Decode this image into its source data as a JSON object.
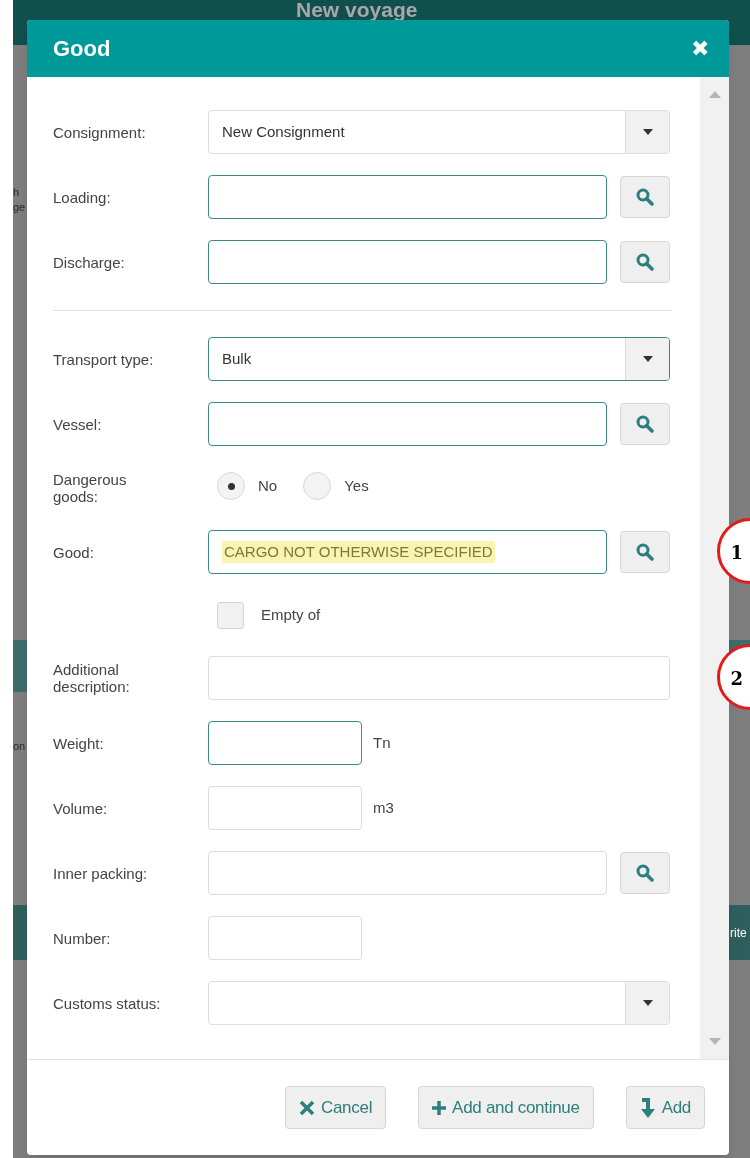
{
  "background": {
    "title": "New voyage",
    "left_fragments": [
      "h",
      "ge",
      "on"
    ],
    "right_fragment": "rite"
  },
  "dialog": {
    "title": "Good",
    "close": "✖",
    "fields": [
      {
        "kind": "select",
        "label": "Consignment:",
        "value": "New Consignment",
        "outlined": false
      },
      {
        "kind": "lookup",
        "label": "Loading:",
        "outlined": true
      },
      {
        "kind": "lookup",
        "label": "Discharge:",
        "outlined": true
      },
      {
        "kind": "divider"
      },
      {
        "kind": "select",
        "label": "Transport type:",
        "value": "Bulk",
        "outlined": true
      },
      {
        "kind": "lookup",
        "label": "Vessel:",
        "outlined": true
      },
      {
        "kind": "radio",
        "label": "Dangerous goods:",
        "options": [
          {
            "label": "No",
            "selected": true
          },
          {
            "label": "Yes",
            "selected": false
          }
        ]
      },
      {
        "kind": "lookup",
        "label": "Good:",
        "value": "CARGO NOT OTHERWISE SPECIFIED",
        "highlighted": true,
        "outlined": true,
        "callout": "1"
      },
      {
        "kind": "checkbox",
        "label": "Empty of",
        "checked": false
      },
      {
        "kind": "text",
        "label": "Additional description:",
        "outlined": false,
        "callout": "2"
      },
      {
        "kind": "short",
        "label": "Weight:",
        "unit": "Tn",
        "outlined": true
      },
      {
        "kind": "short",
        "label": "Volume:",
        "unit": "m3",
        "outlined": false
      },
      {
        "kind": "lookup",
        "label": "Inner packing:",
        "outlined": false
      },
      {
        "kind": "short",
        "label": "Number:",
        "outlined": false
      },
      {
        "kind": "select",
        "label": "Customs status:",
        "outlined": false
      }
    ],
    "buttons": [
      {
        "kind": "cancel",
        "label": "Cancel"
      },
      {
        "kind": "add_continue",
        "label": "Add and continue"
      },
      {
        "kind": "add",
        "label": "Add"
      }
    ]
  }
}
